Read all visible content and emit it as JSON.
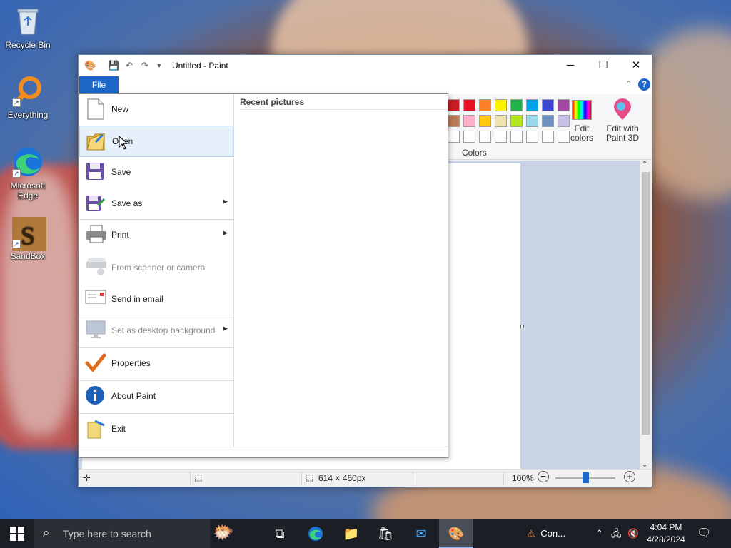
{
  "desktop": {
    "icons": [
      {
        "label": "Recycle Bin",
        "icon": "recycle-bin-icon"
      },
      {
        "label": "Everything",
        "icon": "everything-search-icon"
      },
      {
        "label": "Microsoft Edge",
        "icon": "edge-icon"
      },
      {
        "label": "SandBox",
        "icon": "sandbox-icon"
      }
    ]
  },
  "window": {
    "title": "Untitled - Paint",
    "controls": {
      "minimize": "─",
      "maximize": "☐",
      "close": "✕"
    }
  },
  "ribbon": {
    "file_tab": "File",
    "colors_label": "Colors",
    "edit_colors": "Edit colors",
    "edit_paint3d": "Edit with Paint 3D",
    "palette_row1": [
      "#c81d25",
      "#e81123",
      "#ff7f27",
      "#fff200",
      "#22b14c",
      "#00a2e8",
      "#3f48cc",
      "#a349a4"
    ],
    "palette_row2": [
      "#b97a57",
      "#ffaec9",
      "#ffc90e",
      "#efe4b0",
      "#b5e61d",
      "#99d9ea",
      "#7092be",
      "#c8bfe7"
    ]
  },
  "file_menu": {
    "items": [
      {
        "label": "New",
        "icon": "new-file-icon",
        "submenu": false,
        "disabled": false
      },
      {
        "label": "Open",
        "icon": "open-folder-icon",
        "submenu": false,
        "disabled": false,
        "hovered": true
      },
      {
        "label": "Save",
        "icon": "save-disk-icon",
        "submenu": false,
        "disabled": false
      },
      {
        "label": "Save as",
        "icon": "save-as-icon",
        "submenu": true,
        "disabled": false
      },
      {
        "label": "Print",
        "icon": "printer-icon",
        "submenu": true,
        "disabled": false
      },
      {
        "label": "From scanner or camera",
        "icon": "scanner-icon",
        "submenu": false,
        "disabled": true
      },
      {
        "label": "Send in email",
        "icon": "email-icon",
        "submenu": false,
        "disabled": false
      },
      {
        "label": "Set as desktop background",
        "icon": "desktop-background-icon",
        "submenu": true,
        "disabled": true
      },
      {
        "label": "Properties",
        "icon": "checkmark-icon",
        "submenu": false,
        "disabled": false
      },
      {
        "label": "About Paint",
        "icon": "info-icon",
        "submenu": false,
        "disabled": false
      },
      {
        "label": "Exit",
        "icon": "exit-icon",
        "submenu": false,
        "disabled": false
      }
    ],
    "recent_title": "Recent pictures"
  },
  "statusbar": {
    "size": "614 × 460px",
    "zoom": "100%",
    "zoom_level": 0.5
  },
  "taskbar": {
    "search_placeholder": "Type here to search",
    "tray_label": "Con...",
    "time": "4:04 PM",
    "date": "4/28/2024"
  }
}
